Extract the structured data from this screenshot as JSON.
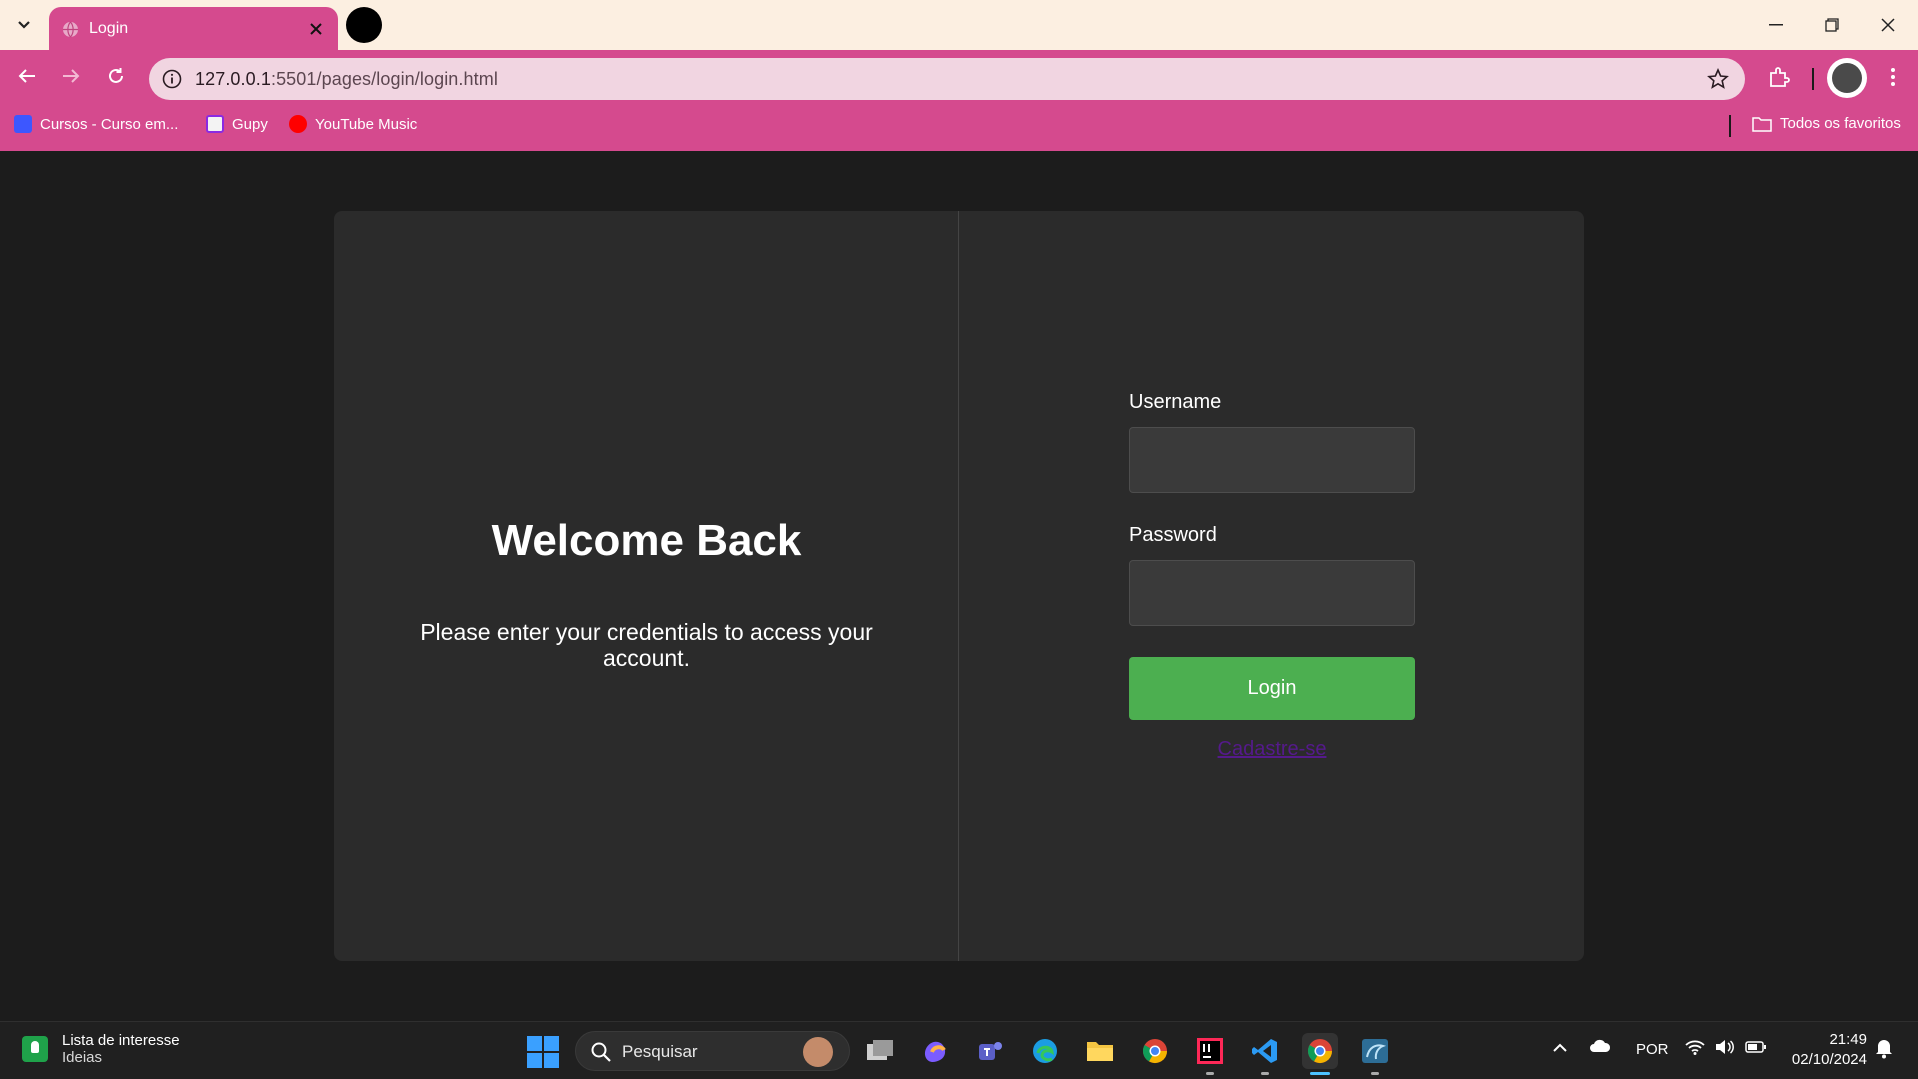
{
  "browser": {
    "tab_title": "Login",
    "url_host": "127.0.0.1",
    "url_rest": ":5501/pages/login/login.html",
    "bookmarks": [
      "Cursos - Curso em...",
      "Gupy",
      "YouTube Music"
    ],
    "all_bookmarks_label": "Todos os favoritos"
  },
  "login": {
    "welcome_title": "Welcome Back",
    "subtitle": "Please enter your credentials to access your account.",
    "username_label": "Username",
    "username_value": "",
    "password_label": "Password",
    "password_value": "",
    "login_button": "Login",
    "signup_link": "Cadastre-se"
  },
  "taskbar": {
    "widget_title": "Lista de interesse",
    "widget_subtitle": "Ideias",
    "search_placeholder": "Pesquisar",
    "language": "POR",
    "time": "21:49",
    "date": "02/10/2024"
  },
  "colors": {
    "accent_chrome": "#d54a8e",
    "login_button": "#4caf50",
    "card_background": "#2b2b2b",
    "page_background": "#1c1c1c"
  }
}
